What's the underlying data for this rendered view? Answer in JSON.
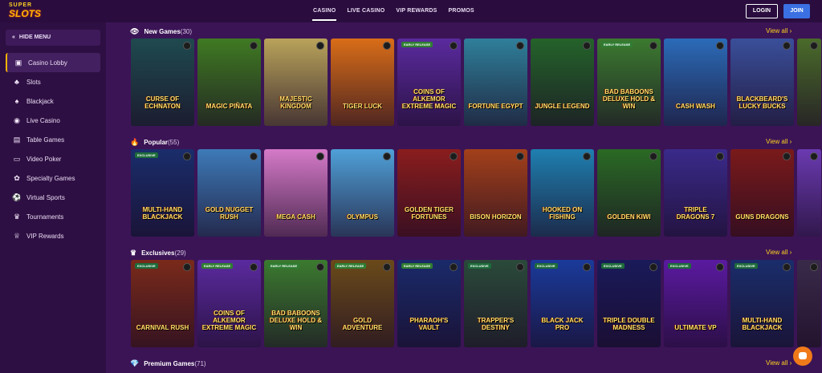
{
  "header": {
    "logo_top": "SUPER",
    "logo_bottom": "SLOTS",
    "nav": [
      "CASINO",
      "LIVE CASINO",
      "VIP REWARDS",
      "PROMOS"
    ],
    "login": "LOGIN",
    "join": "JOIN"
  },
  "sidebar": {
    "hide_menu": "HIDE MENU",
    "items": [
      {
        "label": "Casino Lobby",
        "icon": "casino-lobby-icon",
        "glyph": "▣"
      },
      {
        "label": "Slots",
        "icon": "slots-icon",
        "glyph": "♣"
      },
      {
        "label": "Blackjack",
        "icon": "blackjack-icon",
        "glyph": "♠"
      },
      {
        "label": "Live Casino",
        "icon": "live-casino-icon",
        "glyph": "◉"
      },
      {
        "label": "Table Games",
        "icon": "table-games-icon",
        "glyph": "▤"
      },
      {
        "label": "Video Poker",
        "icon": "video-poker-icon",
        "glyph": "▭"
      },
      {
        "label": "Specialty Games",
        "icon": "specialty-games-icon",
        "glyph": "✿"
      },
      {
        "label": "Virtual Sports",
        "icon": "virtual-sports-icon",
        "glyph": "⚽"
      },
      {
        "label": "Tournaments",
        "icon": "tournaments-icon",
        "glyph": "♛"
      },
      {
        "label": "VIP Rewards",
        "icon": "vip-rewards-icon",
        "glyph": "♕"
      }
    ]
  },
  "sections": [
    {
      "title": "New Games",
      "count": "(30)",
      "view_all": "View all ›",
      "icon": "new-games-icon",
      "glyph": "👁",
      "games": [
        {
          "title": "CURSE OF ECHNATON",
          "color": "#1f4a4f",
          "badge": ""
        },
        {
          "title": "MAGIC PIÑATA",
          "color": "#3f7a22",
          "badge": ""
        },
        {
          "title": "MAJESTIC KINGDOM",
          "color": "#b9a35a",
          "badge": ""
        },
        {
          "title": "TIGER LUCK",
          "color": "#d96d18",
          "badge": ""
        },
        {
          "title": "COINS OF ALKEMOR EXTREME MAGIC",
          "color": "#5a2a9e",
          "badge": "EARLY RELEASE"
        },
        {
          "title": "FORTUNE EGYPT",
          "color": "#2f7f9a",
          "badge": ""
        },
        {
          "title": "JUNGLE LEGEND",
          "color": "#24632a",
          "badge": ""
        },
        {
          "title": "BAD BABOONS DELUXE HOLD & WIN",
          "color": "#3b7a2f",
          "badge": "EARLY RELEASE"
        },
        {
          "title": "CASH WASH",
          "color": "#2b6bb8",
          "badge": ""
        },
        {
          "title": "BLACKBEARD'S LUCKY BUCKS",
          "color": "#3a4f9a",
          "badge": ""
        },
        {
          "title": "",
          "color": "#4a6b2a",
          "badge": ""
        }
      ]
    },
    {
      "title": "Popular",
      "count": "(55)",
      "view_all": "View all ›",
      "icon": "popular-icon",
      "glyph": "🔥",
      "games": [
        {
          "title": "MULTI-HAND BLACKJACK",
          "color": "#1a2d6b",
          "badge": "EXCLUSIVE"
        },
        {
          "title": "GOLD NUGGET RUSH",
          "color": "#3d7ab8",
          "badge": ""
        },
        {
          "title": "MEGA CASH",
          "color": "#d57ac8",
          "badge": ""
        },
        {
          "title": "OLYMPUS",
          "color": "#4fa0d8",
          "badge": ""
        },
        {
          "title": "GOLDEN TIGER FORTUNES",
          "color": "#8a1d1d",
          "badge": ""
        },
        {
          "title": "BISON HORIZON",
          "color": "#a3401a",
          "badge": ""
        },
        {
          "title": "HOOKED ON FISHING",
          "color": "#1f7fb0",
          "badge": ""
        },
        {
          "title": "GOLDEN KIWI",
          "color": "#2a6a24",
          "badge": ""
        },
        {
          "title": "TRIPLE DRAGONS 7",
          "color": "#3a2a8a",
          "badge": ""
        },
        {
          "title": "GUNS DRAGONS",
          "color": "#7a1a1a",
          "badge": ""
        },
        {
          "title": "",
          "color": "#6a3ab0",
          "badge": ""
        }
      ]
    },
    {
      "title": "Exclusives",
      "count": "(29)",
      "view_all": "View all ›",
      "icon": "exclusives-icon",
      "glyph": "♛",
      "games": [
        {
          "title": "CARNIVAL RUSH",
          "color": "#7a2a1a",
          "badge": "EXCLUSIVE"
        },
        {
          "title": "COINS OF ALKEMOR EXTREME MAGIC",
          "color": "#5a2a9e",
          "badge": "EARLY RELEASE"
        },
        {
          "title": "BAD BABOONS DELUXE HOLD & WIN",
          "color": "#3b7a2f",
          "badge": "EARLY RELEASE"
        },
        {
          "title": "GOLD ADVENTURE",
          "color": "#6a4a1a",
          "badge": "EARLY RELEASE"
        },
        {
          "title": "PHARAOH'S VAULT",
          "color": "#1a2a6a",
          "badge": "EARLY RELEASE"
        },
        {
          "title": "TRAPPER'S DESTINY",
          "color": "#2a4a3a",
          "badge": "EXCLUSIVE"
        },
        {
          "title": "BLACK JACK PRO",
          "color": "#1a3a9a",
          "badge": "EXCLUSIVE"
        },
        {
          "title": "TRIPLE DOUBLE MADNESS",
          "color": "#1a1a5a",
          "badge": "EXCLUSIVE"
        },
        {
          "title": "ULTIMATE VP",
          "color": "#5a1aa0",
          "badge": "EXCLUSIVE"
        },
        {
          "title": "MULTI-HAND BLACKJACK",
          "color": "#1a2d6b",
          "badge": "EXCLUSIVE"
        },
        {
          "title": "",
          "color": "#3a2a4a",
          "badge": ""
        }
      ]
    },
    {
      "title": "Premium Games",
      "count": "(71)",
      "view_all": "View all ›",
      "icon": "premium-games-icon",
      "glyph": "💎",
      "games": []
    }
  ]
}
